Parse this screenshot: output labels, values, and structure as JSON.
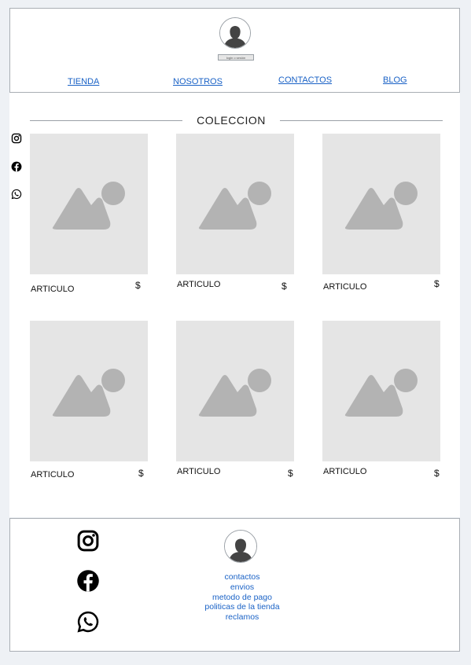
{
  "header": {
    "login_button": "login o sesión",
    "nav": [
      "TIENDA",
      "NOSOTROS",
      "CONTACTOS",
      "BLOG"
    ]
  },
  "main": {
    "section_title": "COLECCION",
    "products": [
      {
        "name": "ARTICULO",
        "price": "$"
      },
      {
        "name": "ARTICULO",
        "price": "$"
      },
      {
        "name": "ARTICULO",
        "price": "$"
      },
      {
        "name": "ARTICULO",
        "price": "$"
      },
      {
        "name": "ARTICULO",
        "price": "$"
      },
      {
        "name": "ARTICULO",
        "price": "$"
      }
    ]
  },
  "social": [
    "instagram-icon",
    "facebook-icon",
    "whatsapp-icon"
  ],
  "footer": {
    "links": [
      "contactos",
      "envios",
      "metodo de pago",
      "politicas de la tienda",
      "reclamos"
    ]
  },
  "colors": {
    "link": "#1a62c6",
    "placeholder": "#e5e5e5",
    "placeholder_glyph": "#b3b3b3",
    "border": "#a9aeb4"
  }
}
